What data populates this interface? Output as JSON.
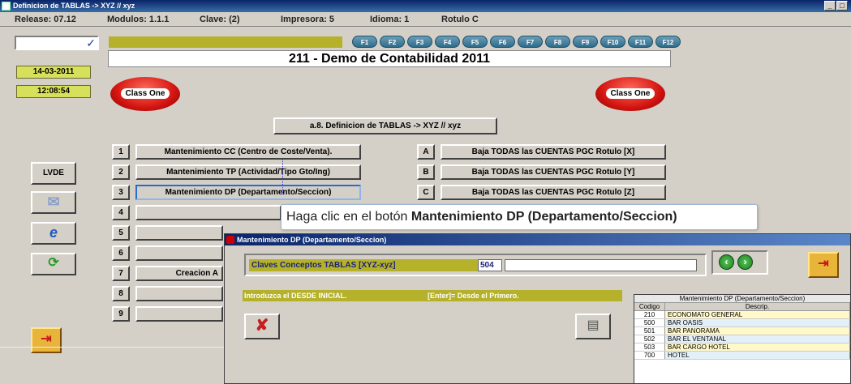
{
  "window": {
    "title": "Definicion de TABLAS  -> XYZ // xyz"
  },
  "info": {
    "release": "Release: 07.12",
    "modulos": "Modulos: 1.1.1",
    "clave": "Clave: (2)",
    "impresora": "Impresora: 5",
    "idioma": "Idioma: 1",
    "rotulo": "Rotulo   C"
  },
  "fkeys": [
    "F1",
    "F2",
    "F3",
    "F4",
    "F5",
    "F6",
    "F7",
    "F8",
    "F9",
    "F10",
    "F11",
    "F12"
  ],
  "company_title": "211 - Demo de Contabilidad 2011",
  "date": "14-03-2011",
  "time": "12:08:54",
  "logo_text": "Class One",
  "section_button": "a.8. Definicion de TABLAS  -> XYZ // xyz",
  "left_menu": [
    {
      "num": "1",
      "label": "Mantenimiento CC (Centro de Coste/Venta)."
    },
    {
      "num": "2",
      "label": "Mantenimiento TP (Actividad/Tipo Gto/Ing)"
    },
    {
      "num": "3",
      "label": "Mantenimiento DP (Departamento/Seccion)"
    },
    {
      "num": "4",
      "label": ""
    },
    {
      "num": "5",
      "label": ""
    },
    {
      "num": "6",
      "label": ""
    },
    {
      "num": "7",
      "label": "Creacion A"
    },
    {
      "num": "8",
      "label": ""
    },
    {
      "num": "9",
      "label": ""
    }
  ],
  "right_menu": [
    {
      "num": "A",
      "label": "Baja TODAS las CUENTAS PGC Rotulo [X]"
    },
    {
      "num": "B",
      "label": "Baja TODAS las CUENTAS PGC Rotulo [Y]"
    },
    {
      "num": "C",
      "label": "Baja TODAS las CUENTAS PGC Rotulo [Z]"
    }
  ],
  "side": {
    "lvde": "LVDE"
  },
  "tooltip": {
    "prefix": "Haga clic en el botón ",
    "bold": "Mantenimiento DP (Departamento/Seccion)"
  },
  "dialog": {
    "title": "Mantenimiento DP (Departamento/Seccion)",
    "claves_label": "Claves Conceptos TABLAS [XYZ-xyz]",
    "claves_value": "504",
    "intro_text": "Introduzca el DESDE INICIAL.",
    "enter_hint": "[Enter]= Desde el Primero."
  },
  "lookup": {
    "title": "Mantenimiento DP (Departamento/Seccion)",
    "headers": [
      "Codigo",
      "Descrip."
    ],
    "rows": [
      [
        "210",
        "ECONOMATO GENERAL"
      ],
      [
        "500",
        "BAR OASIS"
      ],
      [
        "501",
        "BAR PANORAMA"
      ],
      [
        "502",
        "BAR EL VENTANAL"
      ],
      [
        "503",
        "BAR CARGO HOTEL"
      ],
      [
        "700",
        "HOTEL"
      ]
    ]
  },
  "colors": {
    "olive": "#b5b12a",
    "title_blue": "#0a246a",
    "logo_red": "#d41410"
  }
}
